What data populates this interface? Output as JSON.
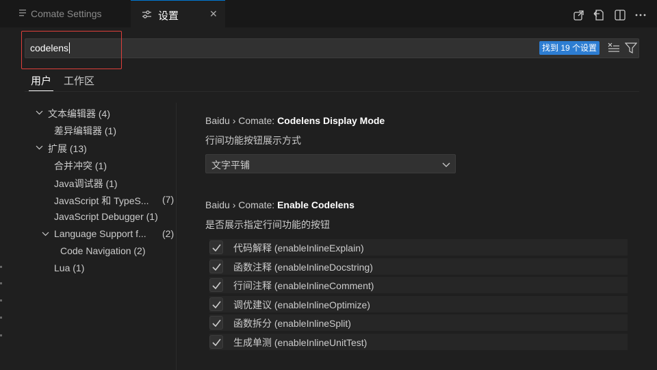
{
  "tabs": [
    {
      "label": "Comate Settings",
      "icon": "list-icon",
      "active": false
    },
    {
      "label": "设置",
      "icon": "settings-sliders-icon",
      "active": true,
      "close_icon": "close-icon"
    }
  ],
  "editor_actions": [
    "open-settings-json-icon",
    "open-previous-editor-icon",
    "split-editor-icon",
    "more-actions-icon"
  ],
  "search": {
    "value": "codelens",
    "results_badge": "找到 19 个设置",
    "clear_icon": "clear-filter-icon",
    "filter_icon": "filter-icon"
  },
  "scope_tabs": [
    {
      "label": "用户",
      "active": true
    },
    {
      "label": "工作区",
      "active": false
    }
  ],
  "toc": [
    {
      "label": "文本编辑器 (4)",
      "expanded": true
    },
    {
      "label": "差异编辑器 (1)"
    },
    {
      "label": "扩展 (13)",
      "expanded": true
    },
    {
      "label": "合并冲突 (1)"
    },
    {
      "label": "Java调试器 (1)"
    },
    {
      "label": "JavaScript 和 TypeS...",
      "count": "(7)"
    },
    {
      "label": "JavaScript Debugger (1)"
    },
    {
      "label": "Language Support f...",
      "count": "(2)",
      "expanded": true
    },
    {
      "label": "Code Navigation (2)"
    },
    {
      "label": "Lua (1)"
    }
  ],
  "settings": [
    {
      "prefix": "Baidu › Comate: ",
      "name": "Codelens Display Mode",
      "description": "行间功能按钮展示方式",
      "select_value": "文字平铺"
    },
    {
      "prefix": "Baidu › Comate: ",
      "name": "Enable Codelens",
      "description": "是否展示指定行间功能的按钮",
      "checkboxes": [
        {
          "label": "代码解释 (enableInlineExplain)",
          "checked": true
        },
        {
          "label": "函数注释 (enableInlineDocstring)",
          "checked": true
        },
        {
          "label": "行间注释 (enableInlineComment)",
          "checked": true
        },
        {
          "label": "调优建议 (enableInlineOptimize)",
          "checked": true
        },
        {
          "label": "函数拆分 (enableInlineSplit)",
          "checked": true
        },
        {
          "label": "生成单测 (enableInlineUnitTest)",
          "checked": true
        }
      ]
    }
  ],
  "colors": {
    "background": "#1f1f1f",
    "tabbar": "#181818",
    "accent": "#0078d4",
    "badge": "#2d7dd2",
    "highlight_box": "#e0403b"
  }
}
